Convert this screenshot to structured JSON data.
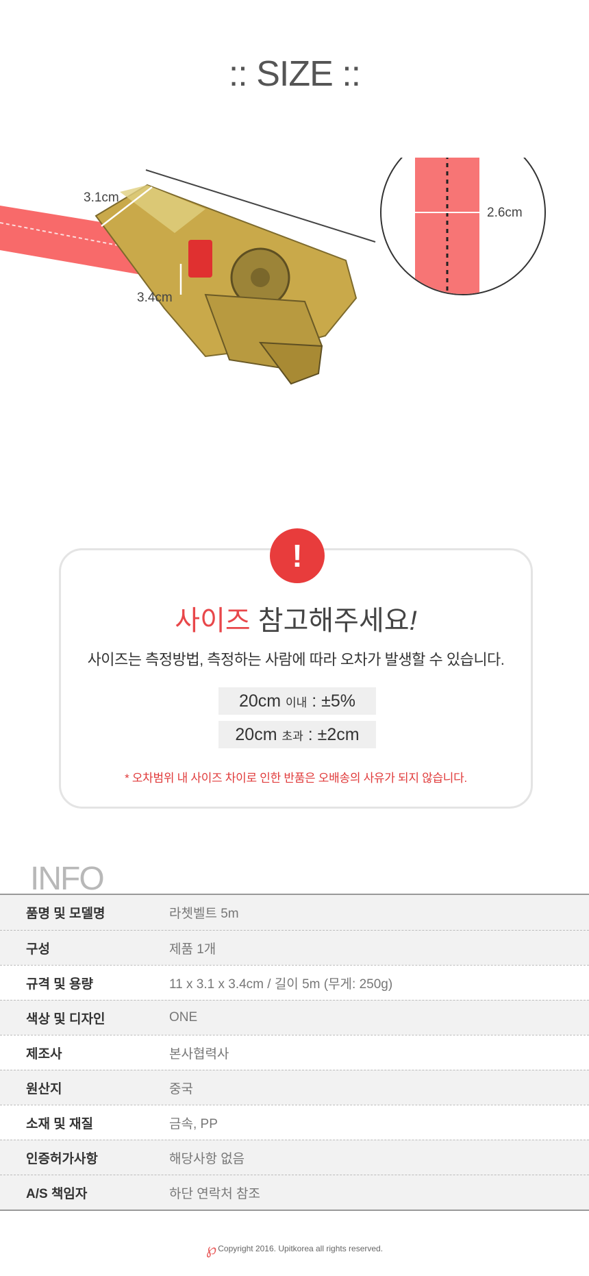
{
  "size_section": {
    "title": ":: SIZE ::",
    "dimensions": {
      "width_label": "3.1cm",
      "height_label": "3.4cm",
      "strap_width_label": "2.6cm"
    }
  },
  "notice": {
    "title_accent": "사이즈",
    "title_rest": " 참고해주세요",
    "title_mark": "!",
    "description": "사이즈는 측정방법, 측정하는 사람에 따라 오차가 발생할 수 있습니다.",
    "tolerance": [
      {
        "size": "20cm",
        "cond": "이내",
        "value": " : ±5%"
      },
      {
        "size": "20cm",
        "cond": "초과",
        "value": " : ±2cm"
      }
    ],
    "warning": "* 오차범위 내 사이즈 차이로 인한 반품은 오배송의 사유가 되지 않습니다.",
    "icon_glyph": "!"
  },
  "info": {
    "title": "INFO",
    "rows": [
      {
        "key": "품명 및 모델명",
        "value": "라쳇벨트 5m"
      },
      {
        "key": "구성",
        "value": "제품 1개"
      },
      {
        "key": "규격 및 용량",
        "value": "11 x 3.1 x 3.4cm / 길이 5m (무게: 250g)"
      },
      {
        "key": "색상 및 디자인",
        "value": "ONE"
      },
      {
        "key": "제조사",
        "value": "본사협력사"
      },
      {
        "key": "원산지",
        "value": "중국"
      },
      {
        "key": "소재 및 재질",
        "value": "금속, PP"
      },
      {
        "key": "인증허가사항",
        "value": "해당사항  없음"
      },
      {
        "key": "A/S 책임자",
        "value": "하단 연락처 참조"
      }
    ]
  },
  "footer": {
    "copyright": "Copyright 2016. Upitkorea all rights reserved."
  },
  "colors": {
    "accent": "#e8474a",
    "strap": "#f86a6a",
    "metal": "#c9a94a"
  }
}
